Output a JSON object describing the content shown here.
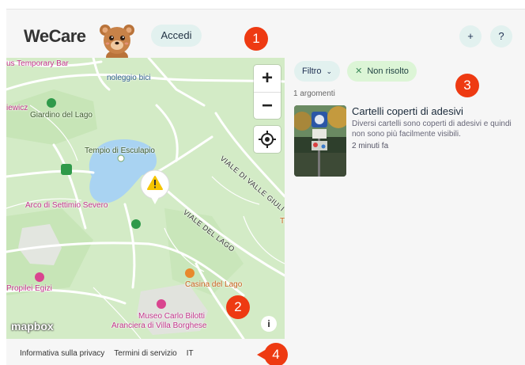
{
  "header": {
    "logo": "WeCare",
    "login_label": "Accedi",
    "add_label": "+",
    "help_label": "?"
  },
  "badges": [
    "1",
    "2",
    "3",
    "4"
  ],
  "map": {
    "labels": {
      "bar": "us Temporary Bar",
      "noleggio": "noleggio bici",
      "iewicz": "iewicz",
      "giardino": "Giardino del Lago",
      "tempio": "Tempio di Esculapio",
      "viale_valle": "VIALE DI VALLE GIULI",
      "arco": "Arco di Settimio Severo",
      "viale_lago": "VIALE DEL LAGO",
      "propilei": "Propilei Egizi",
      "casina": "Casina del Lago",
      "museo": "Museo Carlo Bilotti",
      "aranciera": "Aranciera di Villa Borghese",
      "edge_t": "T"
    },
    "zoom_in": "+",
    "zoom_out": "−",
    "attribution_logo": "mapbox",
    "info_label": "i"
  },
  "filters": {
    "filter_label": "Filtro",
    "filter_chevron": "chevron-down-icon",
    "unresolved_label": "Non risolto",
    "unresolved_icon": "close-icon"
  },
  "results": {
    "count_text": "1 argomenti",
    "items": [
      {
        "title": "Cartelli coperti di adesivi",
        "description": "Diversi cartelli sono coperti di adesivi e quindi non sono più facilmente visibili.",
        "time": "2 minuti fa"
      }
    ]
  },
  "footer": {
    "privacy": "Informativa sulla privacy",
    "terms": "Termini di servizio",
    "language": "IT"
  },
  "colors": {
    "accent_button_bg": "#e2f1ef",
    "badge": "#ee3a12",
    "unresolved_chip_bg": "#dcf5d6",
    "map_green": "#d3ebc6",
    "water": "#a9d3f2",
    "warning": "#f5c400"
  }
}
